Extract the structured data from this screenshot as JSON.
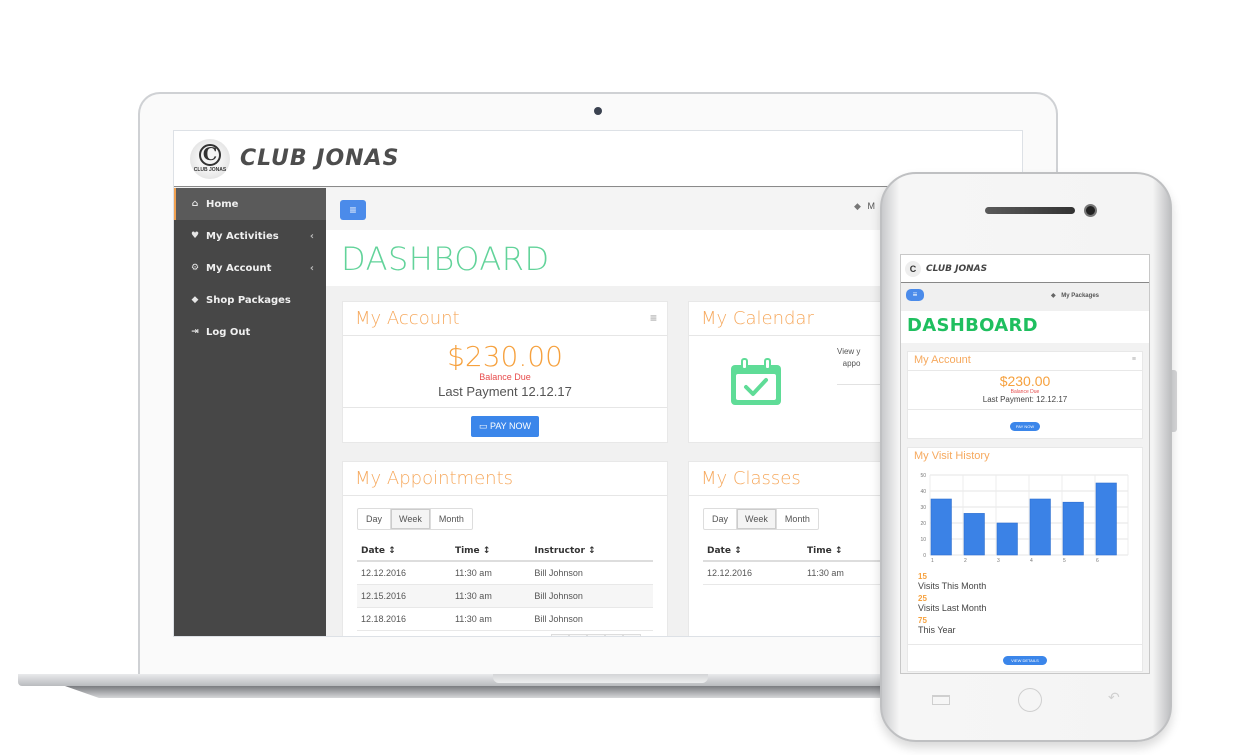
{
  "desktop": {
    "brand": "CLUB JONAS",
    "logo_text": "C",
    "logo_subtext": "CLUB JONAS",
    "sidebar": {
      "items": [
        {
          "label": "Home",
          "icon": "home-icon",
          "glyph": "⌂",
          "active": true,
          "has_chevron": false
        },
        {
          "label": "My Activities",
          "icon": "heartbeat-icon",
          "glyph": "♥",
          "active": false,
          "has_chevron": true
        },
        {
          "label": "My Account",
          "icon": "gear-icon",
          "glyph": "⚙",
          "active": false,
          "has_chevron": true
        },
        {
          "label": "Shop Packages",
          "icon": "tags-icon",
          "glyph": "◆",
          "active": false,
          "has_chevron": false
        },
        {
          "label": "Log Out",
          "icon": "sign-out-icon",
          "glyph": "⇥",
          "active": false,
          "has_chevron": false
        }
      ],
      "chevron": "‹"
    },
    "topbar": {
      "menu_glyph": "≡",
      "packages_label": "M",
      "tag_glyph": "◆"
    },
    "page_title": "DASHBOARD",
    "account_card": {
      "title": "My Account",
      "kebab": "≡",
      "amount": "$230.00",
      "balance_label": "Balance Due",
      "last_payment": "Last Payment 12.12.17",
      "pay_button": "PAY NOW",
      "card_glyph": "▭"
    },
    "calendar_card": {
      "title": "My Calendar",
      "text_line1": "View y",
      "text_line2": "appo"
    },
    "appointments_card": {
      "title": "My Appointments",
      "segments": [
        "Day",
        "Week",
        "Month"
      ],
      "selected_segment": "Week",
      "columns": [
        "Date ↕",
        "Time ↕",
        "Instructor ↕"
      ],
      "rows": [
        [
          "12.12.2016",
          "11:30 am",
          "Bill Johnson"
        ],
        [
          "12.15.2016",
          "11:30 am",
          "Bill Johnson"
        ],
        [
          "12.18.2016",
          "11:30 am",
          "Bill Johnson"
        ]
      ]
    },
    "classes_card": {
      "title": "My Classes",
      "segments": [
        "Day",
        "Week",
        "Month"
      ],
      "selected_segment": "Week",
      "columns": [
        "Date ↕",
        "Time ↕"
      ],
      "rows": [
        [
          "12.12.2016",
          "11:30 am"
        ]
      ]
    }
  },
  "mobile": {
    "brand": "CLUB JONAS",
    "logo_text": "C",
    "menu_glyph": "≡",
    "packages_label": "My Packages",
    "tag_glyph": "◆",
    "page_title": "DASHBOARD",
    "account_card": {
      "title": "My Account",
      "kebab": "≡",
      "amount": "$230.00",
      "balance_label": "Balance Due",
      "last_payment": "Last Payment: 12.12.17",
      "pay_button": "PAY NOW"
    },
    "visit_card": {
      "title": "My Visit History",
      "stats": [
        {
          "value": "15",
          "label": "Visits This Month"
        },
        {
          "value": "25",
          "label": "Visits Last Month"
        },
        {
          "value": "75",
          "label": "This Year"
        }
      ],
      "details_button": "VIEW DETAILS"
    },
    "nav": {
      "back_glyph": "↶"
    }
  },
  "chart_data": {
    "type": "bar",
    "title": "My Visit History",
    "categories": [
      "1",
      "2",
      "3",
      "4",
      "5",
      "6"
    ],
    "values": [
      35,
      26,
      20,
      35,
      33,
      45
    ],
    "xlabel": "",
    "ylabel": "",
    "ylim": [
      0,
      50
    ],
    "yticks": [
      0,
      10,
      20,
      30,
      40,
      50
    ],
    "grid": true,
    "bar_color": "#3b82e6"
  },
  "colors": {
    "accent_green": "#62d39a",
    "mobile_title_green": "#1fbf5f",
    "card_title_orange": "#f6a95e",
    "amount_orange": "#f6a13e",
    "balance_red": "#e74c4c",
    "primary_blue": "#3b86ea",
    "sidebar_bg": "#474747"
  }
}
